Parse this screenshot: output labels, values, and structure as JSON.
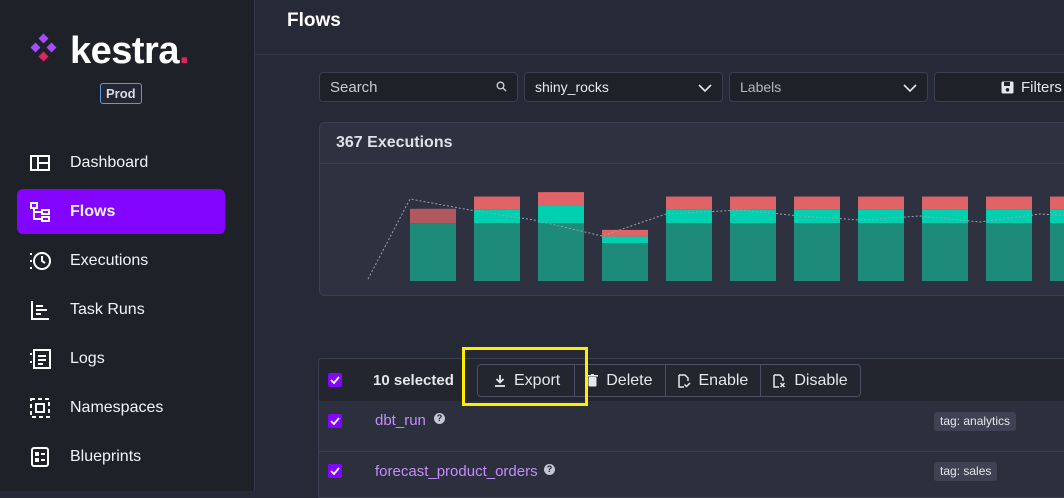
{
  "sidebar": {
    "brand": "kestra",
    "brand_dot": ".",
    "environment": "Prod",
    "items": [
      {
        "label": "Dashboard",
        "icon": "dashboard-icon"
      },
      {
        "label": "Flows",
        "icon": "flows-icon",
        "active": true
      },
      {
        "label": "Executions",
        "icon": "executions-icon"
      },
      {
        "label": "Task Runs",
        "icon": "task-runs-icon"
      },
      {
        "label": "Logs",
        "icon": "logs-icon"
      },
      {
        "label": "Namespaces",
        "icon": "namespaces-icon"
      },
      {
        "label": "Blueprints",
        "icon": "blueprints-icon"
      }
    ]
  },
  "header": {
    "title": "Flows"
  },
  "filters": {
    "search_placeholder": "Search",
    "namespace_value": "shiny_rocks",
    "labels_placeholder": "Labels",
    "filters_label": "Filters"
  },
  "chart": {
    "title": "367 Executions",
    "colors": {
      "success": "#1d8a7a",
      "running": "#00d0b0",
      "failed": "#e06467"
    }
  },
  "chart_data": {
    "type": "bar",
    "title": "367 Executions",
    "xlabel": "",
    "ylabel": "",
    "categories": [
      "",
      "",
      "",
      "",
      "",
      "",
      "",
      "",
      "",
      "",
      ""
    ],
    "series": [
      {
        "name": "",
        "values": [
          52,
          52,
          52,
          34,
          52,
          52,
          52,
          52,
          52,
          52,
          52
        ]
      },
      {
        "name": "",
        "values": [
          0,
          12,
          16,
          6,
          12,
          12,
          12,
          12,
          12,
          12,
          12
        ]
      },
      {
        "name": "",
        "values": [
          13,
          12,
          12,
          6,
          12,
          12,
          12,
          12,
          12,
          12,
          12
        ]
      }
    ],
    "ylim": [
      0,
      90
    ],
    "grid": false
  },
  "table": {
    "selected_text": "10 selected",
    "actions": {
      "export": "Export",
      "delete": "Delete",
      "enable": "Enable",
      "disable": "Disable"
    },
    "rows": [
      {
        "flow": "dbt_run",
        "tag": "tag: analytics"
      },
      {
        "flow": "forecast_product_orders",
        "tag": "tag: sales"
      }
    ]
  }
}
